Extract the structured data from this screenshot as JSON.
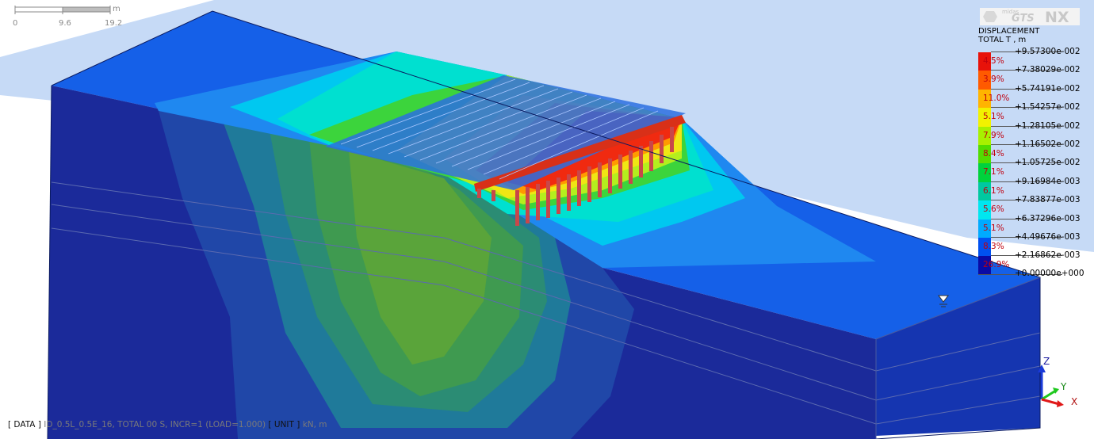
{
  "scale_bar": {
    "unit": "m",
    "ticks": [
      "0",
      "9.6",
      "19.2"
    ]
  },
  "logo": {
    "small": "midas",
    "brand": "GTS",
    "suffix": "NX"
  },
  "legend": {
    "title_line1": "DISPLACEMENT",
    "title_line2": "TOTAL T , m",
    "values": [
      "+9.57300e-002",
      "+7.38029e-002",
      "+5.74191e-002",
      "+1.54257e-002",
      "+1.28105e-002",
      "+1.16502e-002",
      "+1.05725e-002",
      "+9.16984e-003",
      "+7.83877e-003",
      "+6.37296e-003",
      "+4.49676e-003",
      "+2.16862e-003"
    ],
    "bottom_value": "+0.00000e+000",
    "bands": [
      {
        "pct": "4.5%",
        "color": "#e8120a"
      },
      {
        "pct": "3.9%",
        "color": "#ff5a00"
      },
      {
        "pct": "11.0%",
        "color": "#ffb400"
      },
      {
        "pct": "5.1%",
        "color": "#f2f200"
      },
      {
        "pct": "7.9%",
        "color": "#a8f000"
      },
      {
        "pct": "8.4%",
        "color": "#52dc00"
      },
      {
        "pct": "7.1%",
        "color": "#00d23c"
      },
      {
        "pct": "6.1%",
        "color": "#00c8a0"
      },
      {
        "pct": "5.6%",
        "color": "#00e6f0"
      },
      {
        "pct": "5.1%",
        "color": "#00aaff"
      },
      {
        "pct": "8.3%",
        "color": "#0050f0"
      },
      {
        "pct": "26.9%",
        "color": "#0a0aa5"
      }
    ]
  },
  "status_bar": {
    "data_label": "[ DATA ]",
    "data_value": "ID_0.5L_0.5E_16, TOTAL 00 S, INCR=1 (LOAD=1.000)",
    "unit_label": "[ UNIT ]",
    "unit_value": "kN, m"
  },
  "triad": {
    "z": "Z",
    "y": "Y",
    "x": "X"
  }
}
